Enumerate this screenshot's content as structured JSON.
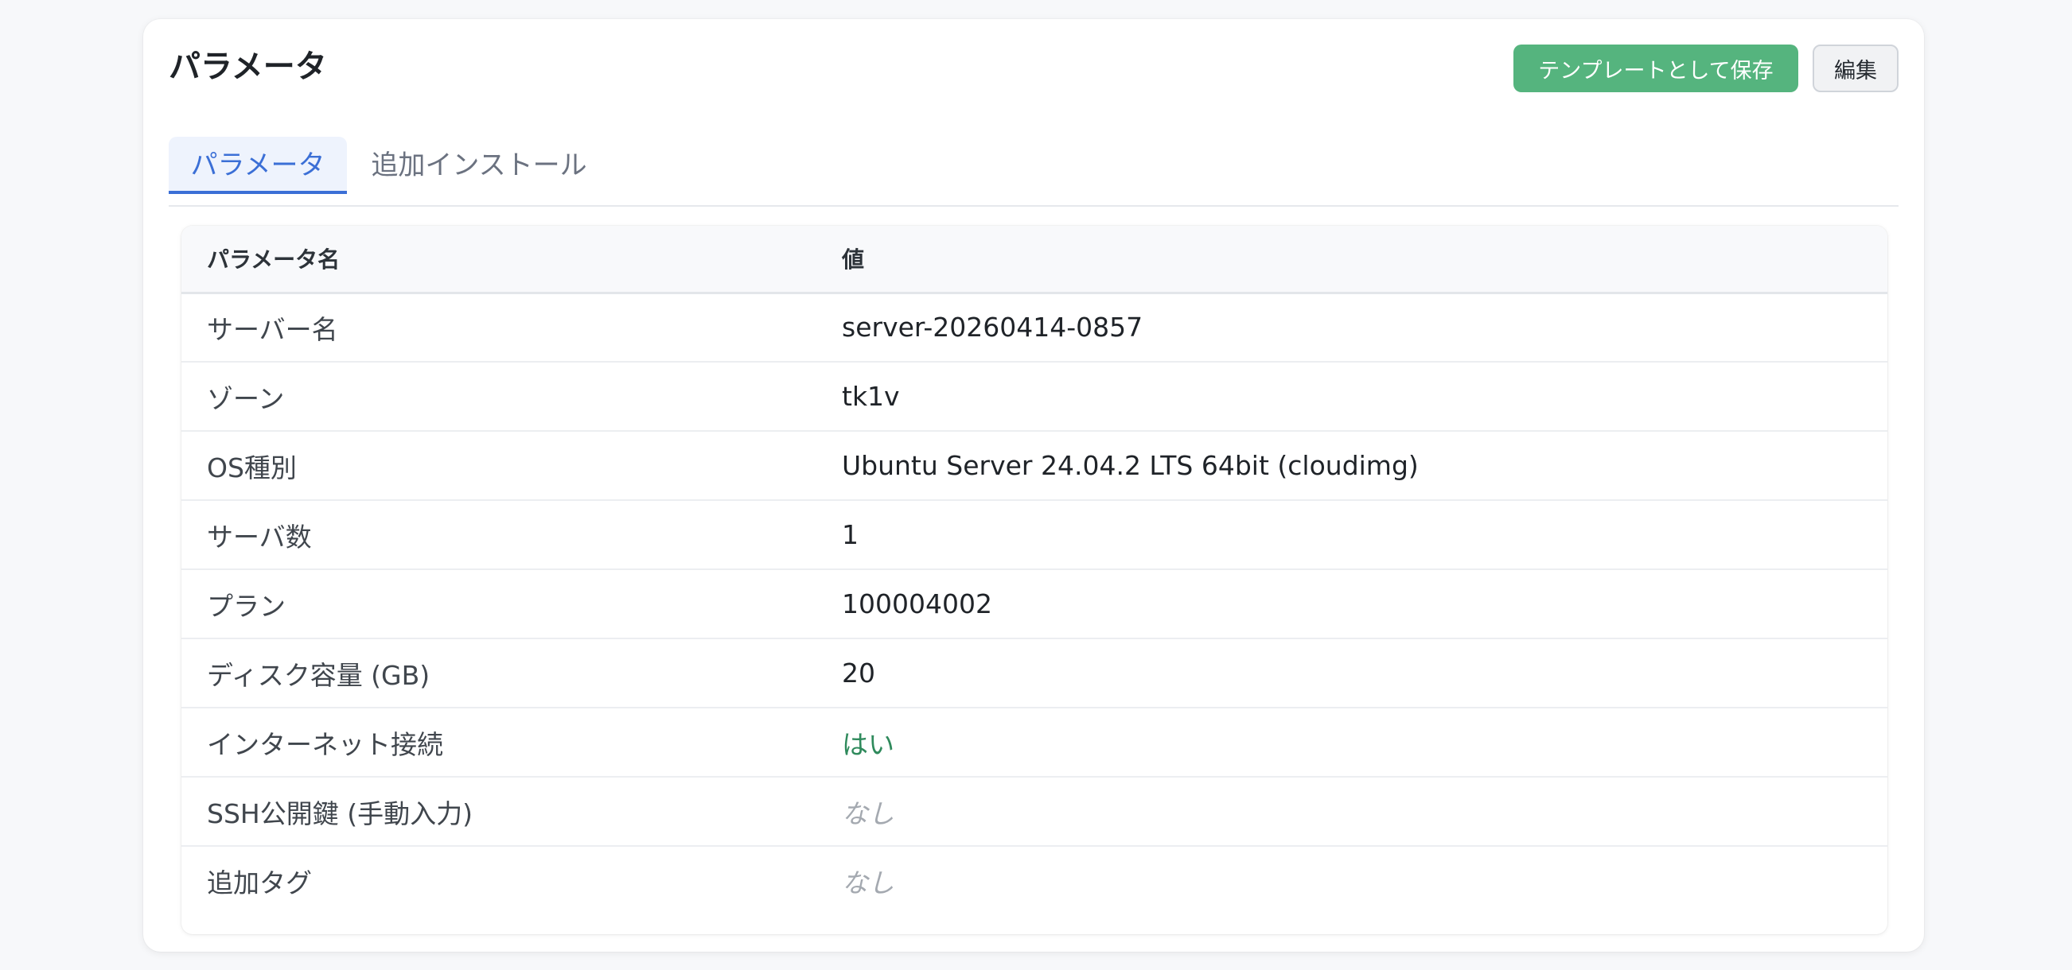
{
  "panel": {
    "title": "パラメータ",
    "save_template_label": "テンプレートとして保存",
    "edit_label": "編集"
  },
  "tabs": [
    {
      "label": "パラメータ",
      "active": true
    },
    {
      "label": "追加インストール",
      "active": false
    }
  ],
  "table": {
    "columns": [
      "パラメータ名",
      "値"
    ],
    "rows": [
      {
        "name": "サーバー名",
        "value": "server-20260414-0857"
      },
      {
        "name": "ゾーン",
        "value": "tk1v"
      },
      {
        "name": "OS種別",
        "value": "Ubuntu Server 24.04.2 LTS 64bit (cloudimg)"
      },
      {
        "name": "サーバ数",
        "value": "1"
      },
      {
        "name": "プラン",
        "value": "100004002"
      },
      {
        "name": "ディスク容量 (GB)",
        "value": "20"
      },
      {
        "name": "インターネット接続",
        "value": "はい"
      },
      {
        "name": "SSH公開鍵 (手動入力)",
        "value": "なし"
      },
      {
        "name": "追加タグ",
        "value": "なし"
      }
    ]
  },
  "colors": {
    "primary_button": "#55b47e",
    "active_tab": "#3b6fd6",
    "yes_value": "#2f8a5c",
    "none_value": "#a4a9b0"
  }
}
